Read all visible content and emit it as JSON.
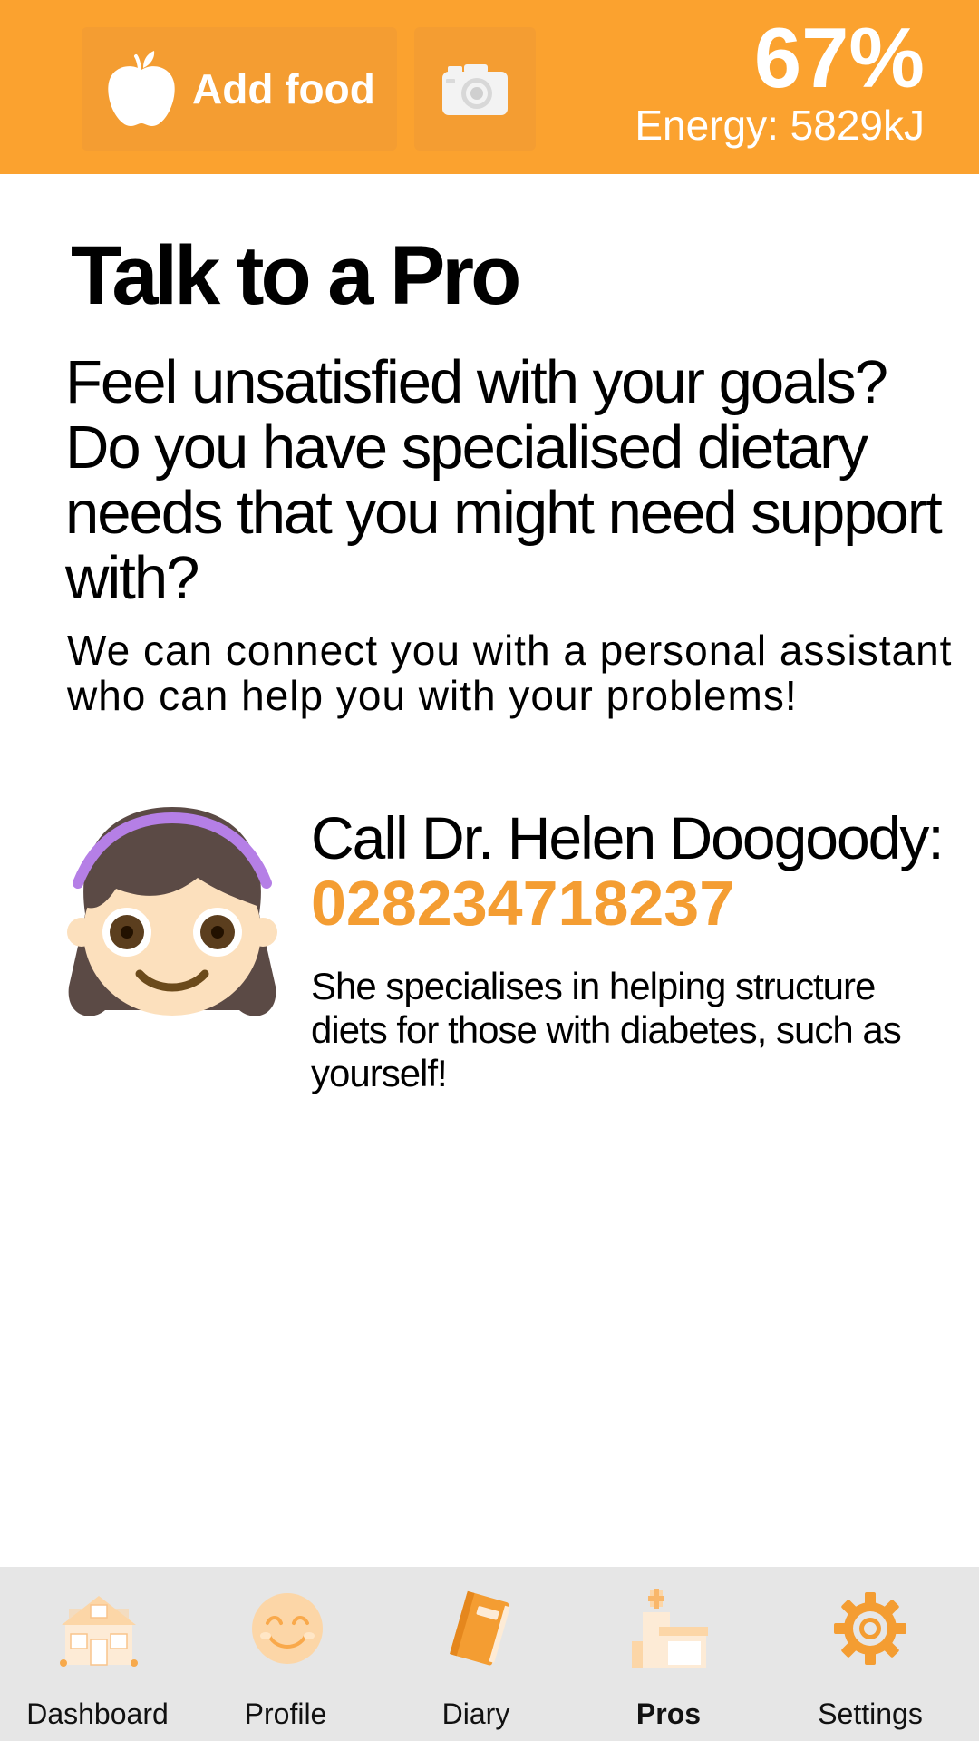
{
  "header": {
    "add_food_label": "Add food",
    "energy_percent": "67%",
    "energy_label": "Energy: 5829kJ",
    "icons": [
      "apple-icon",
      "camera-icon"
    ]
  },
  "main": {
    "title": "Talk to a Pro",
    "intro_question": "Feel unsatisfied with your goals? Do you have specialised dietary needs that you might need support with?",
    "intro_sub": "We can connect you with a personal assistant who can help you with your problems!",
    "pro": {
      "call_label": "Call Dr. Helen Doogoody:",
      "phone": "028234718237",
      "description": "She specialises in helping structure diets for those with diabetes, such as yourself!",
      "avatar_icon": "girl-face-avatar"
    }
  },
  "bottom_nav": {
    "items": [
      {
        "label": "Dashboard",
        "icon": "house-icon",
        "active": false
      },
      {
        "label": "Profile",
        "icon": "smiley-icon",
        "active": false
      },
      {
        "label": "Diary",
        "icon": "notebook-icon",
        "active": false
      },
      {
        "label": "Pros",
        "icon": "hospital-icon",
        "active": true
      },
      {
        "label": "Settings",
        "icon": "gear-icon",
        "active": false
      }
    ]
  },
  "colors": {
    "brand_orange": "#FBA22F",
    "button_orange": "#F49D32",
    "phone_orange": "#F49D32",
    "nav_background": "#E6E6E6",
    "text": "#000000",
    "header_text": "#FFFFFF"
  }
}
